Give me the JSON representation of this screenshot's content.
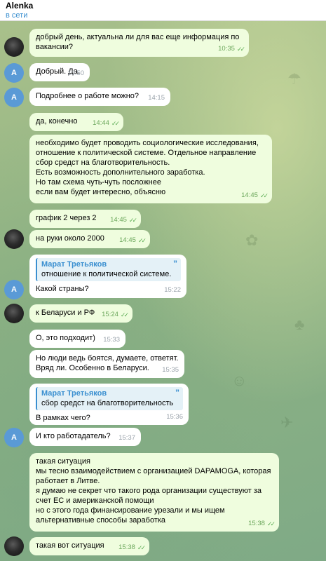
{
  "header": {
    "title": "Alenka",
    "status": "в сети"
  },
  "messages": [
    {
      "text": "добрый день, актуальна ли для вас еще информация по вакансии?",
      "time": "10:35",
      "read": true
    },
    {
      "text": "Добрый. Да.",
      "time": "10:50"
    },
    {
      "text": "Подробнее о работе можно?",
      "time": "14:15"
    },
    {
      "text": "да, конечно",
      "time": "14:44",
      "read": true
    },
    {
      "text": "необходимо будет проводить социологические исследования,\nотношение к политической системе. Отдельное направление\nсбор средст на благотворительность.\nЕсть возможность дополнительного заработка.\nНо там схема чуть-чуть посложнее\nесли вам будет интересно, объясню",
      "time": "14:45",
      "read": true
    },
    {
      "text": "график 2 через 2",
      "time": "14:45",
      "read": true
    },
    {
      "text": "на руки около 2000",
      "time": "14:45",
      "read": true
    },
    {
      "reply_name": "Марат Третьяков",
      "reply_text": "отношение к политической системе.",
      "text": "Какой страны?",
      "time": "15:22"
    },
    {
      "text": "к Беларуси и РФ",
      "time": "15:24",
      "read": true
    },
    {
      "text": "О, это подходит)",
      "time": "15:33"
    },
    {
      "text": "Но люди ведь боятся, думаете, ответят.\nВряд ли. Особенно в Беларуси.",
      "time": "15:35"
    },
    {
      "reply_name": "Марат Третьяков",
      "reply_text": "сбор средст на благотворительность",
      "text": "В рамках чего?",
      "time": "15:36"
    },
    {
      "text": "И кто работадатель?",
      "time": "15:37"
    },
    {
      "text": "такая ситуация\nмы тесно взаимодействием с организацией DAPAMOGA, которая\nработает в Литве.\nя думаю не секрет что такого рода организации существуют за\nсчет ЕС и американской помощи\nно с этого года финансирование урезали и мы ищем\nальтернативные способы заработка",
      "time": "15:38",
      "read": true
    },
    {
      "text": "такая вот ситуация",
      "time": "15:38",
      "read": true
    }
  ],
  "avatar_letter": "A",
  "colors": {
    "outgoing": "#effdde",
    "incoming": "#ffffff",
    "accent": "#3a8fd0",
    "check": "#5fae56"
  }
}
